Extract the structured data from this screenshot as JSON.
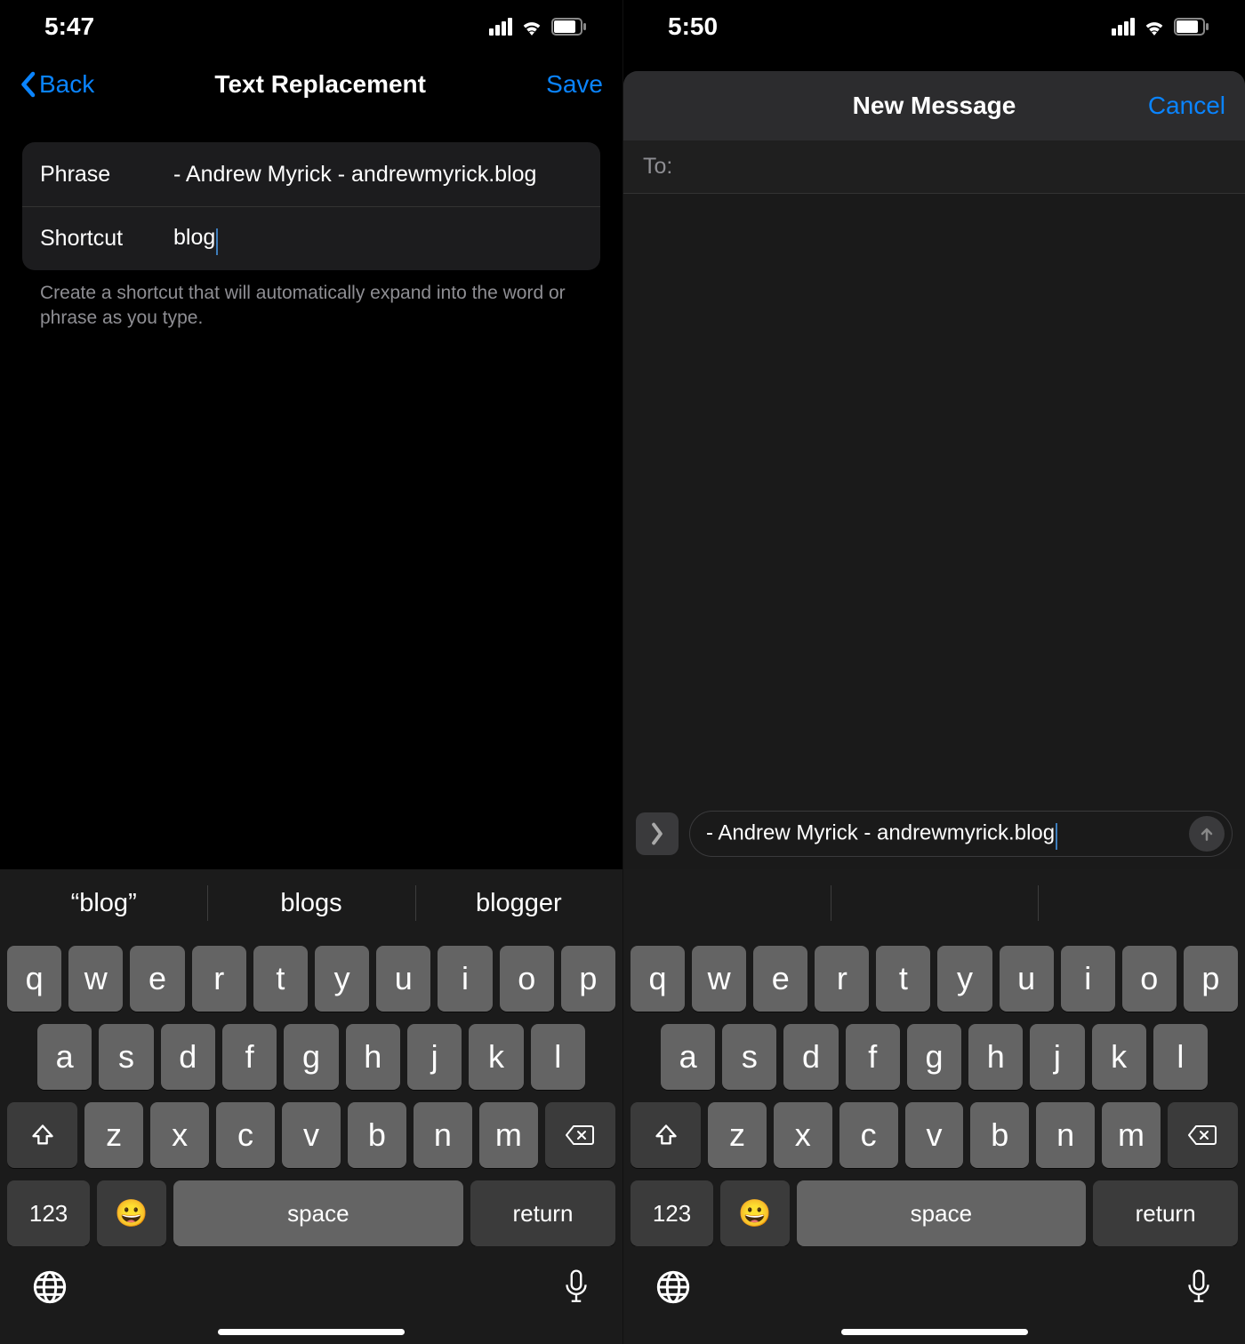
{
  "left": {
    "status_time": "5:47",
    "nav": {
      "back": "Back",
      "title": "Text Replacement",
      "save": "Save"
    },
    "form": {
      "phrase_label": "Phrase",
      "phrase_value": "- Andrew Myrick - andrewmyrick.blog",
      "shortcut_label": "Shortcut",
      "shortcut_value": "blog",
      "footer": "Create a shortcut that will automatically expand into the word or phrase as you type."
    },
    "suggestions": [
      "“blog”",
      "blogs",
      "blogger"
    ]
  },
  "right": {
    "status_time": "5:50",
    "sheet": {
      "title": "New Message",
      "cancel": "Cancel",
      "to_label": "To:"
    },
    "compose_text": "- Andrew Myrick - andrewmyrick.blog",
    "suggestions": [
      "",
      "",
      ""
    ]
  },
  "keyboard": {
    "row1": [
      "q",
      "w",
      "e",
      "r",
      "t",
      "y",
      "u",
      "i",
      "o",
      "p"
    ],
    "row2": [
      "a",
      "s",
      "d",
      "f",
      "g",
      "h",
      "j",
      "k",
      "l"
    ],
    "row3": [
      "z",
      "x",
      "c",
      "v",
      "b",
      "n",
      "m"
    ],
    "num": "123",
    "space": "space",
    "ret": "return",
    "emoji": "😀"
  },
  "colors": {
    "accent": "#0a84ff"
  }
}
